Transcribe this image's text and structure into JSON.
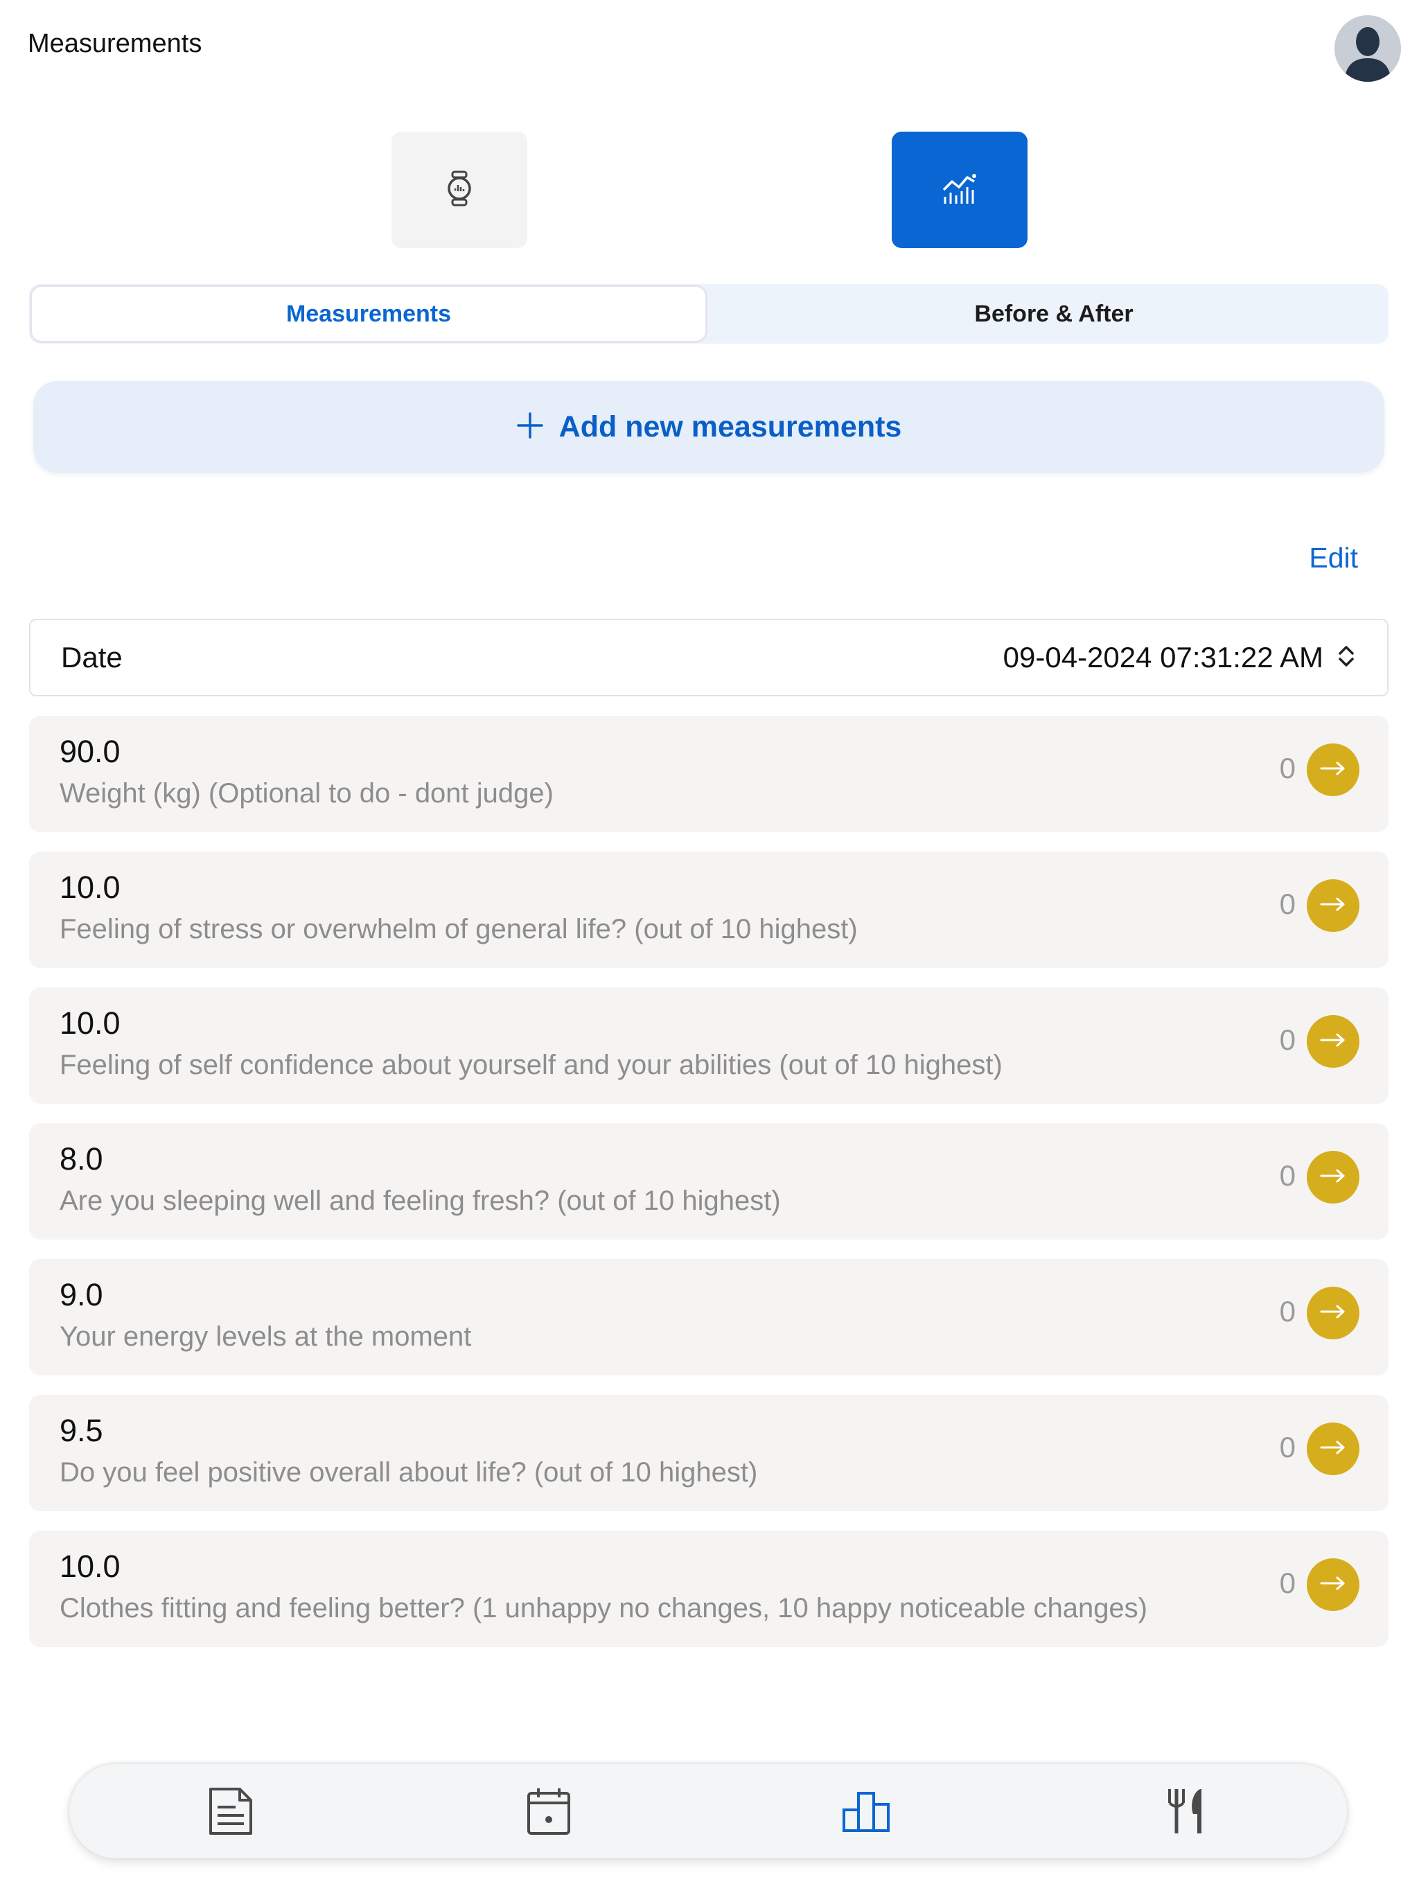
{
  "header": {
    "title": "Measurements",
    "avatar_icon": "user-avatar-icon"
  },
  "view_modes": [
    {
      "name": "watch-view",
      "icon": "smartwatch-icon",
      "active": false
    },
    {
      "name": "chart-view",
      "icon": "chart-icon",
      "active": true
    }
  ],
  "tabs": {
    "measurements_label": "Measurements",
    "before_after_label": "Before & After",
    "active": "Measurements"
  },
  "add_button": {
    "label": "Add new measurements",
    "icon": "plus-icon"
  },
  "edit_label": "Edit",
  "date_row": {
    "label": "Date",
    "value": "09-04-2024 07:31:22 AM",
    "icon": "chevron-up-down-icon"
  },
  "measurements": [
    {
      "value": "90.0",
      "description": "Weight (kg) (Optional to do - dont judge)",
      "count": "0"
    },
    {
      "value": "10.0",
      "description": "Feeling of stress or overwhelm of general life? (out of 10 highest)",
      "count": "0"
    },
    {
      "value": "10.0",
      "description": "Feeling of self confidence about yourself and your abilities (out of 10 highest)",
      "count": "0"
    },
    {
      "value": "8.0",
      "description": "Are you sleeping well and feeling fresh? (out of 10 highest)",
      "count": "0"
    },
    {
      "value": "9.0",
      "description": "Your energy levels at the moment",
      "count": "0"
    },
    {
      "value": "9.5",
      "description": "Do you feel positive overall about life? (out of 10 highest)",
      "count": "0"
    },
    {
      "value": "10.0",
      "description": "Clothes fitting and feeling better? (1 unhappy no changes, 10 happy noticeable changes)",
      "count": "0"
    }
  ],
  "bottom_nav": [
    {
      "name": "notes",
      "icon": "document-icon",
      "active": false
    },
    {
      "name": "calendar",
      "icon": "calendar-icon",
      "active": false
    },
    {
      "name": "progress",
      "icon": "podium-icon",
      "active": true
    },
    {
      "name": "meals",
      "icon": "fork-knife-icon",
      "active": false
    }
  ],
  "colors": {
    "accent": "#0a66d2",
    "arrow_button": "#d6ad1c",
    "card_bg": "#f5f4f3",
    "inactive_icon": "#4a4a4a"
  }
}
